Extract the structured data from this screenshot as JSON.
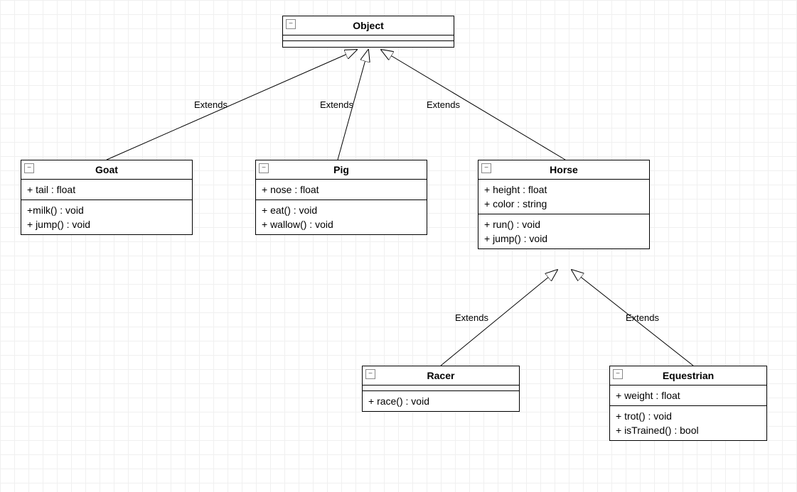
{
  "classes": {
    "object": {
      "name": "Object",
      "attributes": [],
      "methods": []
    },
    "goat": {
      "name": "Goat",
      "attributes": [
        "+ tail : float"
      ],
      "methods": [
        "+milk() : void",
        "+ jump() : void"
      ]
    },
    "pig": {
      "name": "Pig",
      "attributes": [
        "+ nose : float"
      ],
      "methods": [
        "+ eat() : void",
        "+ wallow() : void"
      ]
    },
    "horse": {
      "name": "Horse",
      "attributes": [
        "+ height : float",
        "+ color : string"
      ],
      "methods": [
        "+ run() : void",
        "+ jump() : void"
      ]
    },
    "racer": {
      "name": "Racer",
      "attributes": [],
      "methods": [
        "+ race() : void"
      ]
    },
    "equestrian": {
      "name": "Equestrian",
      "attributes": [
        "+ weight : float"
      ],
      "methods": [
        "+ trot() : void",
        "+ isTrained() : bool"
      ]
    }
  },
  "edges": {
    "goat_object": "Extends",
    "pig_object": "Extends",
    "horse_object": "Extends",
    "racer_horse": "Extends",
    "equestrian_horse": "Extends"
  },
  "icons": {
    "collapse": "−"
  }
}
